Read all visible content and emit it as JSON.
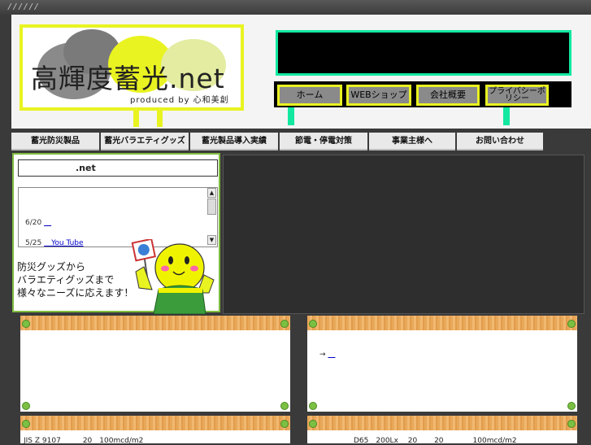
{
  "top_bar": {
    "slashes": "/ / / / / /"
  },
  "logo": {
    "title": "高輝度蓄光.net",
    "subtitle": "produced by 心和美創"
  },
  "nav": [
    {
      "label": "ホーム"
    },
    {
      "label": "WEBショップ"
    },
    {
      "label": "会社概要"
    },
    {
      "label": "プライバシーポリシー"
    }
  ],
  "tabs": [
    {
      "label": "蓄光防災製品"
    },
    {
      "label": "蓄光バラエティグッズ"
    },
    {
      "label": "蓄光製品導入実績"
    },
    {
      "label": "節電・停電対策"
    },
    {
      "label": "事業主様へ"
    },
    {
      "label": "お問い合わせ"
    }
  ],
  "side": {
    "net_label": ".net",
    "news": [
      {
        "date": "6/20",
        "link": "　"
      },
      {
        "date": "5/25",
        "link": "　You Tube"
      }
    ],
    "mascot_text": [
      "防災グッズから",
      "バラエティグッズまで",
      "様々なニーズに応えます！"
    ]
  },
  "cards": {
    "right_top_link_arrow": "→",
    "right_top_link_text": "　",
    "bottom_left_text": "JIS Z 9107　　　20　100mcd/m2",
    "bottom_right_text": "D65　200Lx　 20　　 20　　　　100mcd/m2"
  },
  "colors": {
    "accent_yellow": "#e9f321",
    "accent_green": "#12e8a0",
    "frame_green": "#7fbb3e",
    "wood": "#e8a85a"
  }
}
